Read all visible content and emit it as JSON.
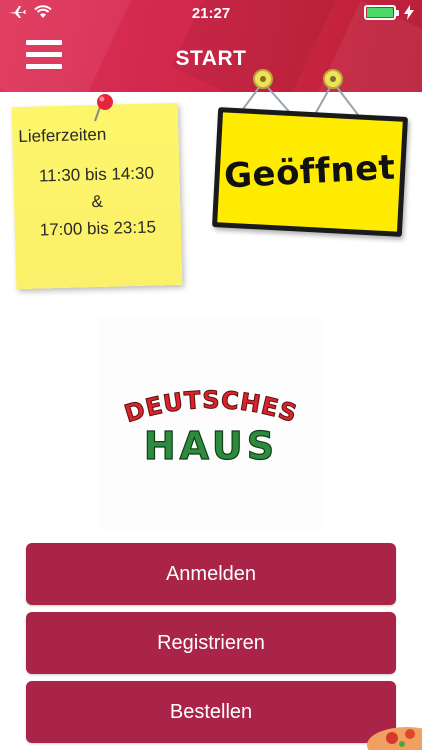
{
  "status_bar": {
    "time": "21:27",
    "battery_color": "#4cd964"
  },
  "header": {
    "title": "START",
    "menu_icon": "hamburger-icon"
  },
  "note": {
    "heading": "Lieferzeiten",
    "line1": "11:30 bis 14:30",
    "line2": "&",
    "line3": "17:00 bis 23:15"
  },
  "sign": {
    "text": "Geöffnet"
  },
  "logo": {
    "line1": "DEUTSCHES",
    "line2": "HAUS",
    "line1_color": "#d8242a",
    "line2_color": "#2e8b3e"
  },
  "buttons": {
    "login": "Anmelden",
    "register": "Registrieren",
    "order": "Bestellen"
  },
  "colors": {
    "header": "#d4294f",
    "button": "#a92446",
    "note": "#fdf66a",
    "sign": "#ffeb00"
  }
}
